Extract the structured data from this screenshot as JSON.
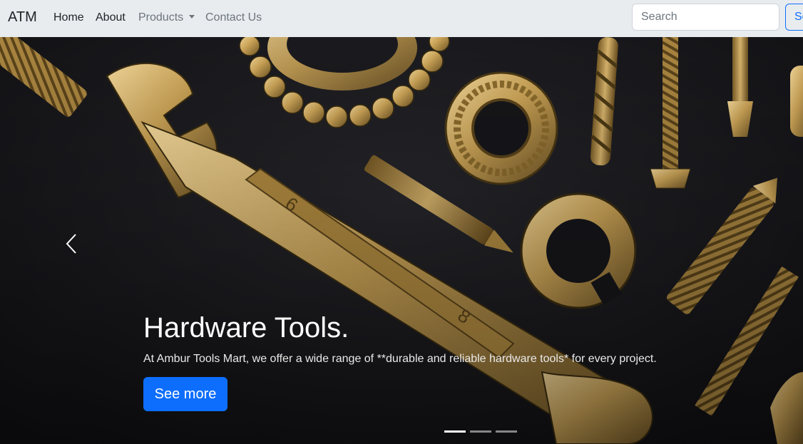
{
  "navbar": {
    "brand": "ATM",
    "links": [
      "Home",
      "About",
      "Products",
      "Contact Us"
    ],
    "search_placeholder": "Search",
    "search_button": "Se"
  },
  "carousel": {
    "slide_title": "Hardware Tools.",
    "slide_text": "At Ambur Tools Mart, we offer a wide range of **durable and reliable hardware tools* for every project.",
    "cta_label": "See more",
    "slides_count": 3,
    "active_slide": 1,
    "prev_icon": "chevron-left-icon"
  },
  "colors": {
    "navbar_bg": "#e9ecef",
    "primary": "#0d6efd",
    "hero_bg": "#16161a",
    "brass": "#c9a256"
  }
}
